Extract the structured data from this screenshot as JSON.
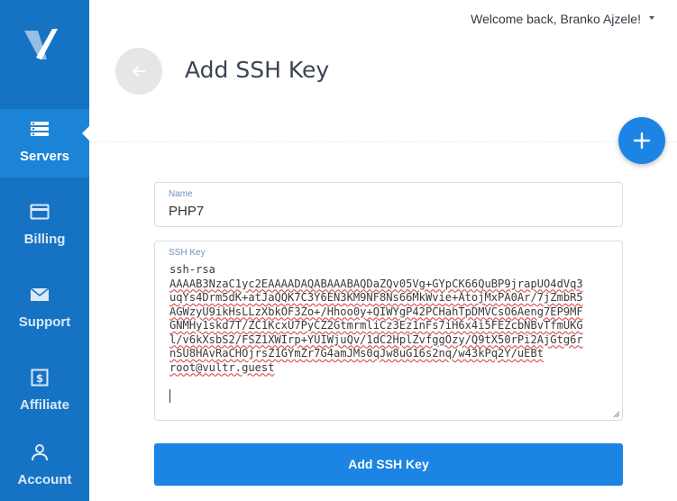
{
  "app": {
    "logo": "vultr-v-logo"
  },
  "sidebar": {
    "items": [
      {
        "label": "Servers",
        "icon": "server-icon",
        "active": true
      },
      {
        "label": "Billing",
        "icon": "credit-card-icon",
        "active": false
      },
      {
        "label": "Support",
        "icon": "envelope-icon",
        "active": false
      },
      {
        "label": "Affiliate",
        "icon": "dollar-icon",
        "active": false
      },
      {
        "label": "Account",
        "icon": "user-icon",
        "active": false
      }
    ]
  },
  "topbar": {
    "welcome": "Welcome back, Branko Ajzele!"
  },
  "header": {
    "title": "Add SSH Key",
    "back_icon": "arrow-left-icon",
    "fab_icon": "plus-icon"
  },
  "form": {
    "name_label": "Name",
    "name_value": "PHP7",
    "key_label": "SSH Key",
    "key_lines": [
      "ssh-rsa",
      "AAAAB3NzaC1yc2EAAAADAQABAAABAQDaZQv05Vg+GYpCK66QuBP9jrapUO4dVq3",
      "uqYs4Drm5dK+atJaQQK7C3Y6EN3KM9NF8Ns66MkWvie+AtojMxPA0Ar/7jZmbR5",
      "AGWzyU9ikHsLLzXbkOF3Zo+/Hhoo0y+QIWYgP42PCHahTpDMVCsO6Aeng7EP9MF",
      "GNMHy1skd7T/ZC1KcxU7PyCZ2GtmrmliCz3Ez1nFs7iH6x4i5FEZcbNBvTfmUKG",
      "l/v6kXsbS2/FSZ1XWIrp+YUIWjuQv/1dC2HplZvfggOzy/Q9tX50rPi2AjGtg6r",
      "nSU8HAvRaCHOjrsZ1GYmZr7G4amJMs0qJw8uG16s2nq/w43kPq2Y/uEBt",
      "root@vultr.guest"
    ],
    "submit_label": "Add SSH Key"
  },
  "colors": {
    "sidebar": "#1673c4",
    "sidebar_active": "#1b84d7",
    "accent": "#1b84e4"
  }
}
